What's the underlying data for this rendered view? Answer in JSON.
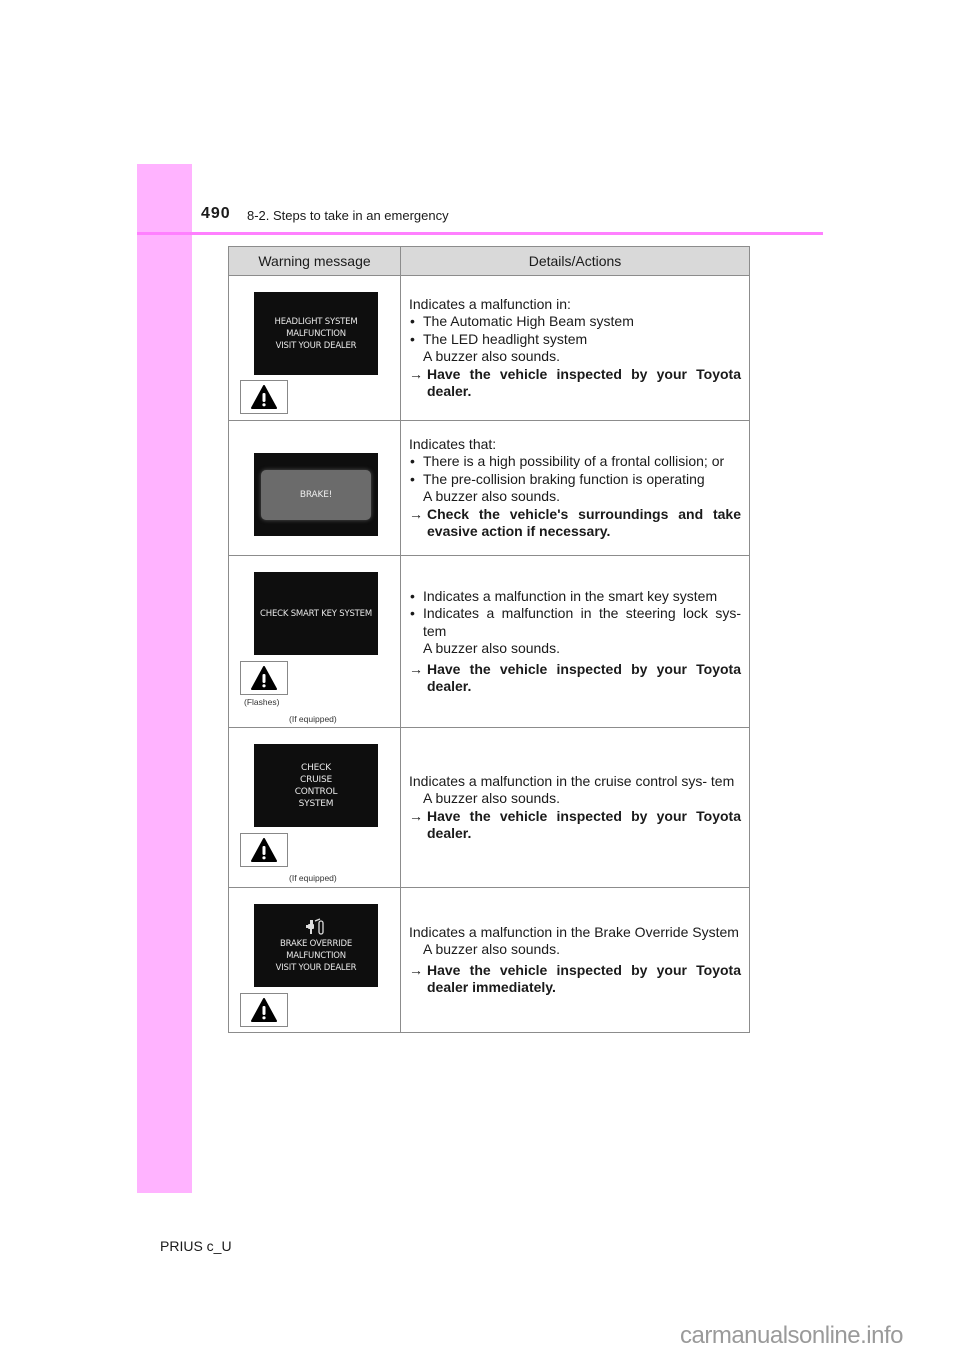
{
  "header": {
    "page_number": "490",
    "section": "8-2. Steps to take in an emergency"
  },
  "colors": {
    "side_tab": "#ffb3ff",
    "header_rule": "#ff80ff",
    "table_header_bg": "#d9d9d9"
  },
  "table": {
    "columns": [
      "Warning message",
      "Details/Actions"
    ],
    "rows": [
      {
        "display_lines": [
          "HEADLIGHT SYSTEM",
          "MALFUNCTION",
          "VISIT YOUR DEALER"
        ],
        "icon": "warning-triangle-icon",
        "lead": "Indicates a malfunction in:",
        "bullets": [
          "The Automatic High Beam system",
          "The LED headlight system"
        ],
        "note": "A buzzer also sounds.",
        "action": "Have the vehicle inspected by your Toyota dealer."
      },
      {
        "display_lines": [
          "BRAKE!"
        ],
        "lead": "Indicates that:",
        "bullets": [
          "There is a high possibility of a frontal collision; or",
          "The pre-collision braking function is operating"
        ],
        "note": "A buzzer also sounds.",
        "action": "Check the vehicle's surroundings and take evasive action if necessary."
      },
      {
        "display_lines": [
          "CHECK SMART KEY SYSTEM"
        ],
        "icon": "warning-triangle-icon",
        "icon_caption": "(Flashes)",
        "equipped_note": "(If equipped)",
        "bullets": [
          "Indicates a malfunction in the smart key system",
          "Indicates a malfunction in the steering lock sys- tem"
        ],
        "note": "A buzzer also sounds.",
        "action": "Have the vehicle inspected by your Toyota dealer."
      },
      {
        "display_lines": [
          "CHECK",
          "CRUISE",
          "CONTROL",
          "SYSTEM"
        ],
        "icon": "warning-triangle-icon",
        "equipped_note": "(If equipped)",
        "lead": "Indicates a malfunction in the cruise control sys- tem",
        "note": "A buzzer also sounds.",
        "action": "Have the vehicle inspected by your Toyota dealer."
      },
      {
        "display_icon": "brake-override-icon",
        "display_lines": [
          "BRAKE OVERRIDE",
          "MALFUNCTION",
          "VISIT YOUR DEALER"
        ],
        "icon": "warning-triangle-icon",
        "lead": "Indicates a malfunction in the Brake Override System",
        "note": "A buzzer also sounds.",
        "action": "Have the vehicle inspected by your Toyota dealer immediately."
      }
    ],
    "arrow_glyph": "→"
  },
  "footer": {
    "model": "PRIUS c_U",
    "watermark": "carmanualsonline.info"
  }
}
